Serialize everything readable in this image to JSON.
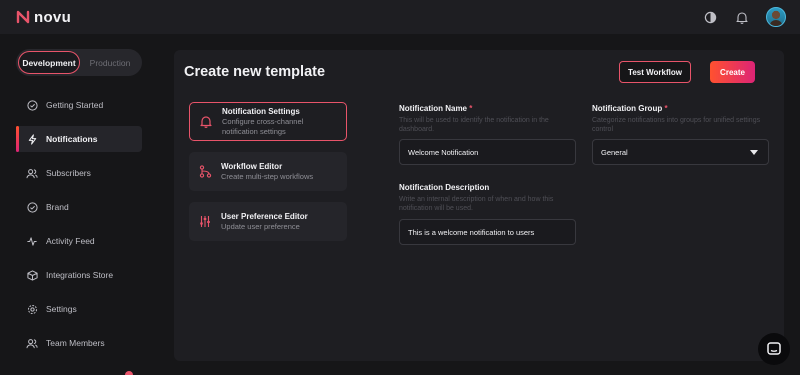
{
  "app": {
    "name": "novu"
  },
  "colors": {
    "accent": "#e8546a",
    "gradient_start": "#ff512f",
    "gradient_end": "#dd2476"
  },
  "topbar": {
    "icons": [
      "theme-toggle-icon",
      "bell-icon",
      "avatar"
    ]
  },
  "environment": {
    "options": [
      "Development",
      "Production"
    ],
    "selected": "Development"
  },
  "sidebar": {
    "items": [
      {
        "label": "Getting Started",
        "icon": "check-circle-icon"
      },
      {
        "label": "Notifications",
        "icon": "bolt-icon",
        "active": true
      },
      {
        "label": "Subscribers",
        "icon": "users-icon"
      },
      {
        "label": "Brand",
        "icon": "check-badge-icon"
      },
      {
        "label": "Activity Feed",
        "icon": "activity-icon"
      },
      {
        "label": "Integrations Store",
        "icon": "cube-icon"
      },
      {
        "label": "Settings",
        "icon": "gear-icon"
      },
      {
        "label": "Team Members",
        "icon": "team-icon"
      }
    ]
  },
  "main": {
    "title": "Create new template",
    "test_button": "Test Workflow",
    "create_button": "Create",
    "steps": [
      {
        "title": "Notification Settings",
        "desc": "Configure cross-channel notification settings",
        "icon": "bell-icon",
        "active": true
      },
      {
        "title": "Workflow Editor",
        "desc": "Create multi-step workflows",
        "icon": "workflow-icon"
      },
      {
        "title": "User Preference Editor",
        "desc": "Update user preference",
        "icon": "sliders-icon"
      }
    ],
    "fields": {
      "name": {
        "label": "Notification Name",
        "required": "*",
        "desc": "This will be used to identify the notification in the dashboard.",
        "value": "Welcome Notification"
      },
      "group": {
        "label": "Notification Group",
        "required": "*",
        "desc": "Categorize notifications into groups for unified settings control",
        "value": "General"
      },
      "description": {
        "label": "Notification Description",
        "desc": "Write an internal description of when and how this notification will be used.",
        "value": "This is a welcome notification to users"
      }
    }
  },
  "chat": {
    "icon": "chat-icon"
  }
}
